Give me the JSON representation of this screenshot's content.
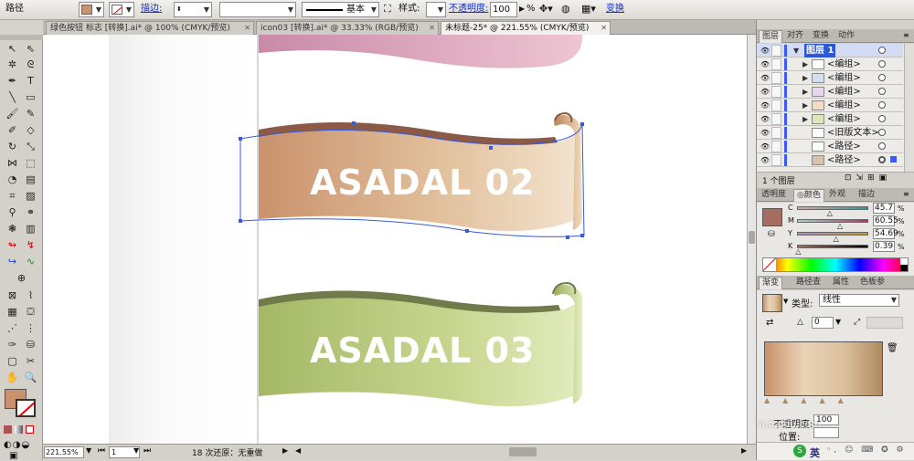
{
  "control_bar": {
    "object_type": "路径",
    "stroke_link": "描边:",
    "stroke_width": "",
    "brush_style_label": "基本",
    "style_label": "样式:",
    "opacity_link": "不透明度:",
    "opacity_value": "100",
    "opacity_unit": "%",
    "transform_link": "变换"
  },
  "doc_tabs": [
    {
      "label": "绿色按钮 标志 [转换].ai* @ 100% (CMYK/预览)",
      "active": false
    },
    {
      "label": "icon03 [转换].ai* @ 33.33% (RGB/预览)",
      "active": false
    },
    {
      "label": "未标题-25* @ 221.55% (CMYK/预览)",
      "active": true
    }
  ],
  "canvas": {
    "banner2_text": "ASADAL 02",
    "banner3_text": "ASADAL 03"
  },
  "status": {
    "zoom": "221.55%",
    "artboard": "1",
    "undo_text": "18 次还原：无重做"
  },
  "layers_panel": {
    "tabs": [
      "图层",
      "对齐",
      "变换",
      "动作"
    ],
    "rows": [
      {
        "name": "图层 1",
        "level": 0,
        "selected": true
      },
      {
        "name": "<编组>",
        "level": 1
      },
      {
        "name": "<编组>",
        "level": 1
      },
      {
        "name": "<编组>",
        "level": 1
      },
      {
        "name": "<编组>",
        "level": 1
      },
      {
        "name": "<编组>",
        "level": 1
      },
      {
        "name": "<旧版文本>",
        "level": 1
      },
      {
        "name": "<路径>",
        "level": 1
      },
      {
        "name": "<路径>",
        "level": 1
      }
    ],
    "footer": "1 个图层"
  },
  "color_panel": {
    "tabs": [
      "透明度",
      "颜色",
      "外观",
      "描边"
    ],
    "fill_color": "#a56d62",
    "channels": [
      {
        "label": "C",
        "value": "45.7",
        "fraction": 0.457
      },
      {
        "label": "M",
        "value": "60.55",
        "fraction": 0.6055
      },
      {
        "label": "Y",
        "value": "54.69",
        "fraction": 0.5469
      },
      {
        "label": "K",
        "value": "0.39",
        "fraction": 0.0039
      }
    ]
  },
  "gradient_panel": {
    "tabs": [
      "渐变",
      "路径查",
      "属性",
      "色板参"
    ],
    "type_label": "类型:",
    "type_value": "线性",
    "angle_value": "0",
    "opacity_label": "不透明度:",
    "opacity_value": "100",
    "location_label": "位置:",
    "colors": [
      "#c9926c",
      "#e9d3b6",
      "#dcc19f",
      "#b08a60"
    ]
  },
  "taskbar": {
    "ime_label": "英",
    "watermark": "n.baidu.com"
  },
  "colors": {
    "banner2_dark": "#c9926c",
    "banner2_light": "#f3e4cf",
    "banner3_dark": "#a9bd6c",
    "banner3_light": "#dfeab8",
    "selection": "#3a5ad8"
  }
}
